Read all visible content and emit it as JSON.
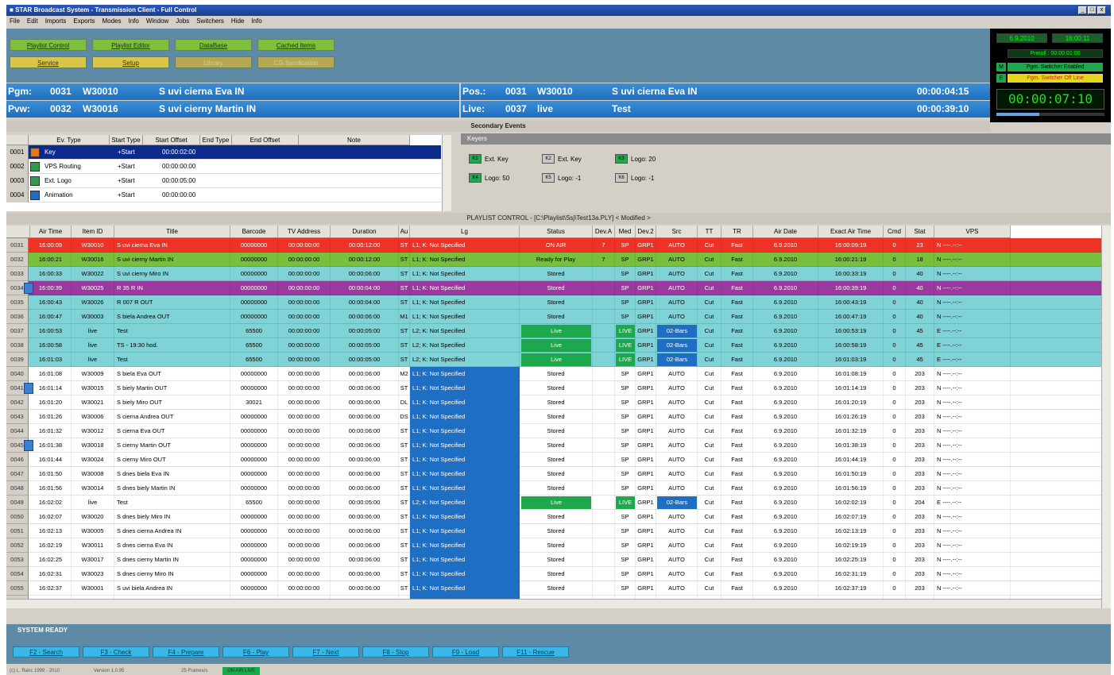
{
  "window": {
    "title": "STAR Broadcast System - Transmission Client - Full Control",
    "controls": [
      "_",
      "□",
      "x"
    ]
  },
  "menu": [
    "File",
    "Edit",
    "Imports",
    "Exports",
    "Modes",
    "Info",
    "Window",
    "Jobs",
    "Switchers",
    "Hide",
    "Info"
  ],
  "toolbar": {
    "row1": [
      {
        "label": "Playlist Control",
        "state": "green"
      },
      {
        "label": "Playlist Editor",
        "state": "green"
      },
      {
        "label": "DataBase",
        "state": "green"
      },
      {
        "label": "Cached Items",
        "state": "green"
      }
    ],
    "row2": [
      {
        "label": "Service",
        "state": "yellow"
      },
      {
        "label": "Setup",
        "state": "yellow"
      },
      {
        "label": "Library",
        "state": "disabled"
      },
      {
        "label": "CG Syndication",
        "state": "disabled"
      }
    ]
  },
  "clock_panel": {
    "date": "6.9.2010",
    "time": "16:00:11",
    "preroll": "Preroll : 00:00:01:00",
    "switch1": "Pgm. Switcher Enabled",
    "switch2": "Pgm. Switcher Off Line",
    "big_clock": "00:00:07:10"
  },
  "pgm": {
    "label": "Pgm:",
    "num": "0031",
    "id": "W30010",
    "title": "S uvi cierna Eva IN"
  },
  "pvw": {
    "label": "Pvw:",
    "num": "0032",
    "id": "W30016",
    "title": "S uvi cierny Martin IN"
  },
  "pos": {
    "label": "Pos.:",
    "num": "0031",
    "id": "W30010",
    "title": "S uvi cierna Eva IN",
    "tc": "00:00:04:15"
  },
  "live": {
    "label": "Live:",
    "num": "0037",
    "id": "live",
    "title": "Test",
    "tc": "00:00:39:10"
  },
  "secondary": {
    "title": "Secondary Events",
    "headers": [
      "Ev. Type",
      "Start Type",
      "Start Offset",
      "End Type",
      "End Offset",
      "Note"
    ],
    "rows": [
      {
        "num": "0001",
        "type": "Key",
        "start_type": "+Start",
        "offset": "00:00:02:00",
        "selected": true
      },
      {
        "num": "0002",
        "type": "VPS Routing",
        "start_type": "+Start",
        "offset": "00:00:00:00",
        "selected": false
      },
      {
        "num": "0003",
        "type": "Ext. Logo",
        "start_type": "+Start",
        "offset": "00:00:05:00",
        "selected": false
      },
      {
        "num": "0004",
        "type": "Animation",
        "start_type": "+Start",
        "offset": "00:00:00:00",
        "selected": false
      }
    ]
  },
  "keyers": {
    "title": "Keyers",
    "items": [
      {
        "label": "Ext. Key",
        "on": true,
        "tag": "K1"
      },
      {
        "label": "Ext. Key",
        "on": false,
        "tag": "K2"
      },
      {
        "label": "Logo: 20",
        "on": true,
        "tag": "K3"
      },
      {
        "label": "Logo: 50",
        "on": true,
        "tag": "K4"
      },
      {
        "label": "Logo: -1",
        "on": false,
        "tag": "K5"
      },
      {
        "label": "Logo: -1",
        "on": false,
        "tag": "K6"
      }
    ]
  },
  "playlist": {
    "title": "PLAYLIST CONTROL - [C:\\Playlist\\Ssj\\Test13a.PLY] < Modified >",
    "headers": [
      "Air Time",
      "Item ID",
      "Title",
      "Barcode",
      "TV Address",
      "Duration",
      "Au",
      "Lg",
      "Status",
      "Dev.A",
      "Med",
      "Dev.2",
      "Src",
      "TT",
      "TR",
      "Air Date",
      "Exact Air Time",
      "Cmd",
      "Stat",
      "VPS"
    ],
    "rows": [
      {
        "n": "0031",
        "ic": false,
        "air": "16:00:09",
        "id": "W30010",
        "title": "S uvi cierna Eva IN",
        "bc": "00000000",
        "tva": "00:00:00:00",
        "dur": "00:00:12:00",
        "au": "ST",
        "lg": "L1; K: Not Specified",
        "status": "ON AIR",
        "deva": "7",
        "med": "SP",
        "dev2": "GRP1",
        "src": "AUTO",
        "tt": "Cut",
        "tr": "Fast",
        "date": "6.9.2010",
        "exact": "16:00:09:19",
        "cmd": "0",
        "stat": "23",
        "vps": "N ----.--:--",
        "bg": "onair"
      },
      {
        "n": "0032",
        "ic": false,
        "air": "16:00:21",
        "id": "W30016",
        "title": "S uvi cierny Martin IN",
        "bc": "00000000",
        "tva": "00:00:00:00",
        "dur": "00:00:12:00",
        "au": "ST",
        "lg": "L1; K: Not Specified",
        "status": "Ready for Play",
        "deva": "7",
        "med": "SP",
        "dev2": "GRP1",
        "src": "AUTO",
        "tt": "Cut",
        "tr": "Fast",
        "date": "6.9.2010",
        "exact": "16:00:21:19",
        "cmd": "0",
        "stat": "18",
        "vps": "N ----.--:--",
        "bg": "ready"
      },
      {
        "n": "0033",
        "ic": false,
        "air": "16:00:33",
        "id": "W30022",
        "title": "S uvi cierny Miro IN",
        "bc": "00000000",
        "tva": "00:00:00:00",
        "dur": "00:00:06:00",
        "au": "ST",
        "lg": "L1; K: Not Specified",
        "status": "Stored",
        "deva": "",
        "med": "SP",
        "dev2": "GRP1",
        "src": "AUTO",
        "tt": "Cut",
        "tr": "Fast",
        "date": "6.9.2010",
        "exact": "16:00:33:19",
        "cmd": "0",
        "stat": "40",
        "vps": "N ----.--:--",
        "bg": "cyan"
      },
      {
        "n": "0034",
        "ic": true,
        "air": "16:00:39",
        "id": "W30025",
        "title": "R 35 R IN",
        "bc": "00000000",
        "tva": "00:00:00:00",
        "dur": "00:00:04:00",
        "au": "ST",
        "lg": "L1; K: Not Specified",
        "status": "Stored",
        "deva": "",
        "med": "SP",
        "dev2": "GRP1",
        "src": "AUTO",
        "tt": "Cut",
        "tr": "Fast",
        "date": "6.9.2010",
        "exact": "16:00:39:19",
        "cmd": "0",
        "stat": "40",
        "vps": "N ----.--:--",
        "bg": "purple"
      },
      {
        "n": "0035",
        "ic": false,
        "air": "16:00:43",
        "id": "W30026",
        "title": "R 007 R OUT",
        "bc": "00000000",
        "tva": "00:00:00:00",
        "dur": "00:00:04:00",
        "au": "ST",
        "lg": "L1; K: Not Specified",
        "status": "Stored",
        "deva": "",
        "med": "SP",
        "dev2": "GRP1",
        "src": "AUTO",
        "tt": "Cut",
        "tr": "Fast",
        "date": "6.9.2010",
        "exact": "16:00:43:19",
        "cmd": "0",
        "stat": "40",
        "vps": "N ----.--:--",
        "bg": "cyan"
      },
      {
        "n": "0036",
        "ic": false,
        "air": "16:00:47",
        "id": "W30003",
        "title": "S biela Andrea OUT",
        "bc": "00000000",
        "tva": "00:00:00:00",
        "dur": "00:00:06:00",
        "au": "M1",
        "lg": "L1; K: Not Specified",
        "status": "Stored",
        "deva": "",
        "med": "SP",
        "dev2": "GRP1",
        "src": "AUTO",
        "tt": "Cut",
        "tr": "Fast",
        "date": "6.9.2010",
        "exact": "16:00:47:19",
        "cmd": "0",
        "stat": "40",
        "vps": "N ----.--:--",
        "bg": "cyan"
      },
      {
        "n": "0037",
        "ic": false,
        "air": "16:00:53",
        "id": "live",
        "title": "Test",
        "bc": "65500",
        "tva": "00:00:00:00",
        "dur": "00:00:05:00",
        "au": "ST",
        "lg": "L2; K: Not Specified",
        "status": "Live",
        "deva": "",
        "med": "LIVE",
        "dev2": "GRP1",
        "src": "02-Bars",
        "tt": "Cut",
        "tr": "Fast",
        "date": "6.9.2010",
        "exact": "16:00:53:19",
        "cmd": "0",
        "stat": "45",
        "vps": "E ----.--:--",
        "bg": "cyan"
      },
      {
        "n": "0038",
        "ic": false,
        "air": "16:00:58",
        "id": "live",
        "title": "TS - 19:30 hod.",
        "bc": "65500",
        "tva": "00:00:00:00",
        "dur": "00:00:05:00",
        "au": "ST",
        "lg": "L2; K: Not Specified",
        "status": "Live",
        "deva": "",
        "med": "LIVE",
        "dev2": "GRP1",
        "src": "02-Bars",
        "tt": "Cut",
        "tr": "Fast",
        "date": "6.9.2010",
        "exact": "16:00:58:19",
        "cmd": "0",
        "stat": "45",
        "vps": "E ----.--:--",
        "bg": "cyan"
      },
      {
        "n": "0039",
        "ic": false,
        "air": "16:01:03",
        "id": "live",
        "title": "Test",
        "bc": "65500",
        "tva": "00:00:00:00",
        "dur": "00:00:05:00",
        "au": "ST",
        "lg": "L2; K: Not Specified",
        "status": "Live",
        "deva": "",
        "med": "LIVE",
        "dev2": "GRP1",
        "src": "02-Bars",
        "tt": "Cut",
        "tr": "Fast",
        "date": "6.9.2010",
        "exact": "16:01:03:19",
        "cmd": "0",
        "stat": "45",
        "vps": "E ----.--:--",
        "bg": "cyan"
      },
      {
        "n": "0040",
        "ic": false,
        "air": "16:01:08",
        "id": "W30009",
        "title": "S biela Eva OUT",
        "bc": "00000000",
        "tva": "00:00:00:00",
        "dur": "00:00:06:00",
        "au": "M2",
        "lg": "L1; K: Not Specified",
        "status": "Stored",
        "deva": "",
        "med": "SP",
        "dev2": "GRP1",
        "src": "AUTO",
        "tt": "Cut",
        "tr": "Fast",
        "date": "6.9.2010",
        "exact": "16:01:08:19",
        "cmd": "0",
        "stat": "203",
        "vps": "N ----.--:--",
        "bg": "white"
      },
      {
        "n": "0041",
        "ic": true,
        "air": "16:01:14",
        "id": "W30015",
        "title": "S biely Martin OUT",
        "bc": "00000000",
        "tva": "00:00:00:00",
        "dur": "00:00:06:00",
        "au": "ST",
        "lg": "L1; K: Not Specified",
        "status": "Stored",
        "deva": "",
        "med": "SP",
        "dev2": "GRP1",
        "src": "AUTO",
        "tt": "Cut",
        "tr": "Fast",
        "date": "6.9.2010",
        "exact": "16:01:14:19",
        "cmd": "0",
        "stat": "203",
        "vps": "N ----.--:--",
        "bg": "white"
      },
      {
        "n": "0042",
        "ic": false,
        "air": "16:01:20",
        "id": "W30021",
        "title": "S biely Miro OUT",
        "bc": "30021",
        "tva": "00:00:00:00",
        "dur": "00:00:06:00",
        "au": "DL",
        "lg": "L1; K: Not Specified",
        "status": "Stored",
        "deva": "",
        "med": "SP",
        "dev2": "GRP1",
        "src": "AUTO",
        "tt": "Cut",
        "tr": "Fast",
        "date": "6.9.2010",
        "exact": "16:01:20:19",
        "cmd": "0",
        "stat": "203",
        "vps": "N ----.--:--",
        "bg": "white"
      },
      {
        "n": "0043",
        "ic": false,
        "air": "16:01:26",
        "id": "W30006",
        "title": "S cierna Andrea OUT",
        "bc": "00000000",
        "tva": "00:00:00:00",
        "dur": "00:00:06:00",
        "au": "DS",
        "lg": "L1; K: Not Specified",
        "status": "Stored",
        "deva": "",
        "med": "SP",
        "dev2": "GRP1",
        "src": "AUTO",
        "tt": "Cut",
        "tr": "Fast",
        "date": "6.9.2010",
        "exact": "16:01:26:19",
        "cmd": "0",
        "stat": "203",
        "vps": "N ----.--:--",
        "bg": "white"
      },
      {
        "n": "0044",
        "ic": false,
        "air": "16:01:32",
        "id": "W30012",
        "title": "S cierna Eva OUT",
        "bc": "00000000",
        "tva": "00:00:00:00",
        "dur": "00:00:06:00",
        "au": "ST",
        "lg": "L1; K: Not Specified",
        "status": "Stored",
        "deva": "",
        "med": "SP",
        "dev2": "GRP1",
        "src": "AUTO",
        "tt": "Cut",
        "tr": "Fast",
        "date": "6.9.2010",
        "exact": "16:01:32:19",
        "cmd": "0",
        "stat": "203",
        "vps": "N ----.--:--",
        "bg": "white"
      },
      {
        "n": "0045",
        "ic": true,
        "air": "16:01:38",
        "id": "W30018",
        "title": "S cierny Martin OUT",
        "bc": "00000000",
        "tva": "00:00:00:00",
        "dur": "00:00:06:00",
        "au": "ST",
        "lg": "L1; K: Not Specified",
        "status": "Stored",
        "deva": "",
        "med": "SP",
        "dev2": "GRP1",
        "src": "AUTO",
        "tt": "Cut",
        "tr": "Fast",
        "date": "6.9.2010",
        "exact": "16:01:38:19",
        "cmd": "0",
        "stat": "203",
        "vps": "N ----.--:--",
        "bg": "white"
      },
      {
        "n": "0046",
        "ic": false,
        "air": "16:01:44",
        "id": "W30024",
        "title": "S cierny Miro OUT",
        "bc": "00000000",
        "tva": "00:00:00:00",
        "dur": "00:00:06:00",
        "au": "ST",
        "lg": "L1; K: Not Specified",
        "status": "Stored",
        "deva": "",
        "med": "SP",
        "dev2": "GRP1",
        "src": "AUTO",
        "tt": "Cut",
        "tr": "Fast",
        "date": "6.9.2010",
        "exact": "16:01:44:19",
        "cmd": "0",
        "stat": "203",
        "vps": "N ----.--:--",
        "bg": "white"
      },
      {
        "n": "0047",
        "ic": false,
        "air": "16:01:50",
        "id": "W30008",
        "title": "S dnes biela Eva IN",
        "bc": "00000000",
        "tva": "00:00:00:00",
        "dur": "00:00:06:00",
        "au": "ST",
        "lg": "L1; K: Not Specified",
        "status": "Stored",
        "deva": "",
        "med": "SP",
        "dev2": "GRP1",
        "src": "AUTO",
        "tt": "Cut",
        "tr": "Fast",
        "date": "6.9.2010",
        "exact": "16:01:50:19",
        "cmd": "0",
        "stat": "203",
        "vps": "N ----.--:--",
        "bg": "white"
      },
      {
        "n": "0048",
        "ic": false,
        "air": "16:01:56",
        "id": "W30014",
        "title": "S dnes biely Martin IN",
        "bc": "00000000",
        "tva": "00:00:00:00",
        "dur": "00:00:06:00",
        "au": "ST",
        "lg": "L1; K: Not Specified",
        "status": "Stored",
        "deva": "",
        "med": "SP",
        "dev2": "GRP1",
        "src": "AUTO",
        "tt": "Cut",
        "tr": "Fast",
        "date": "6.9.2010",
        "exact": "16:01:56:19",
        "cmd": "0",
        "stat": "203",
        "vps": "N ----.--:--",
        "bg": "white"
      },
      {
        "n": "0049",
        "ic": false,
        "air": "16:02:02",
        "id": "live",
        "title": "Test",
        "bc": "65500",
        "tva": "00:00:00:00",
        "dur": "00:00:05:00",
        "au": "ST",
        "lg": "L2; K: Not Specified",
        "status": "Live",
        "deva": "",
        "med": "LIVE",
        "dev2": "GRP1",
        "src": "02-Bars",
        "tt": "Cut",
        "tr": "Fast",
        "date": "6.9.2010",
        "exact": "16:02:02:19",
        "cmd": "0",
        "stat": "204",
        "vps": "E ----.--:--",
        "bg": "white"
      },
      {
        "n": "0050",
        "ic": false,
        "air": "16:02:07",
        "id": "W30020",
        "title": "S dnes biely Miro IN",
        "bc": "00000000",
        "tva": "00:00:00:00",
        "dur": "00:00:06:00",
        "au": "ST",
        "lg": "L1; K: Not Specified",
        "status": "Stored",
        "deva": "",
        "med": "SP",
        "dev2": "GRP1",
        "src": "AUTO",
        "tt": "Cut",
        "tr": "Fast",
        "date": "6.9.2010",
        "exact": "16:02:07:19",
        "cmd": "0",
        "stat": "203",
        "vps": "N ----.--:--",
        "bg": "white"
      },
      {
        "n": "0051",
        "ic": false,
        "air": "16:02:13",
        "id": "W30005",
        "title": "S dnes cierna Andrea IN",
        "bc": "00000000",
        "tva": "00:00:00:00",
        "dur": "00:00:06:00",
        "au": "ST",
        "lg": "L1; K: Not Specified",
        "status": "Stored",
        "deva": "",
        "med": "SP",
        "dev2": "GRP1",
        "src": "AUTO",
        "tt": "Cut",
        "tr": "Fast",
        "date": "6.9.2010",
        "exact": "16:02:13:19",
        "cmd": "0",
        "stat": "203",
        "vps": "N ----.--:--",
        "bg": "white"
      },
      {
        "n": "0052",
        "ic": false,
        "air": "16:02:19",
        "id": "W30011",
        "title": "S dnes cierna Eva IN",
        "bc": "00000000",
        "tva": "00:00:00:00",
        "dur": "00:00:06:00",
        "au": "ST",
        "lg": "L1; K: Not Specified",
        "status": "Stored",
        "deva": "",
        "med": "SP",
        "dev2": "GRP1",
        "src": "AUTO",
        "tt": "Cut",
        "tr": "Fast",
        "date": "6.9.2010",
        "exact": "16:02:19:19",
        "cmd": "0",
        "stat": "203",
        "vps": "N ----.--:--",
        "bg": "white"
      },
      {
        "n": "0053",
        "ic": false,
        "air": "16:02:25",
        "id": "W30017",
        "title": "S dnes cierny Martin IN",
        "bc": "00000000",
        "tva": "00:00:00:00",
        "dur": "00:00:06:00",
        "au": "ST",
        "lg": "L1; K: Not Specified",
        "status": "Stored",
        "deva": "",
        "med": "SP",
        "dev2": "GRP1",
        "src": "AUTO",
        "tt": "Cut",
        "tr": "Fast",
        "date": "6.9.2010",
        "exact": "16:02:25:19",
        "cmd": "0",
        "stat": "203",
        "vps": "N ----.--:--",
        "bg": "white"
      },
      {
        "n": "0054",
        "ic": false,
        "air": "16:02:31",
        "id": "W30023",
        "title": "S dnes cierny Miro IN",
        "bc": "00000000",
        "tva": "00:00:00:00",
        "dur": "00:00:06:00",
        "au": "ST",
        "lg": "L1; K: Not Specified",
        "status": "Stored",
        "deva": "",
        "med": "SP",
        "dev2": "GRP1",
        "src": "AUTO",
        "tt": "Cut",
        "tr": "Fast",
        "date": "6.9.2010",
        "exact": "16:02:31:19",
        "cmd": "0",
        "stat": "203",
        "vps": "N ----.--:--",
        "bg": "white"
      },
      {
        "n": "0055",
        "ic": false,
        "air": "16:02:37",
        "id": "W30001",
        "title": "S uvi biela Andrea IN",
        "bc": "00000000",
        "tva": "00:00:00:00",
        "dur": "00:00:06:00",
        "au": "ST",
        "lg": "L1; K: Not Specified",
        "status": "Stored",
        "deva": "",
        "med": "SP",
        "dev2": "GRP1",
        "src": "AUTO",
        "tt": "Cut",
        "tr": "Fast",
        "date": "6.9.2010",
        "exact": "16:02:37:19",
        "cmd": "0",
        "stat": "203",
        "vps": "N ----.--:--",
        "bg": "white"
      },
      {
        "n": "0056",
        "ic": false,
        "air": "16:02:43",
        "id": "W30007",
        "title": "S uvi biela Eva IN",
        "bc": "00000000",
        "tva": "00:00:00:00",
        "dur": "00:00:06:00",
        "au": "ST",
        "lg": "L1; K: Not Specified",
        "status": "Stored",
        "deva": "",
        "med": "SP",
        "dev2": "GRP1",
        "src": "AUTO",
        "tt": "Cut",
        "tr": "Fast",
        "date": "6.9.2010",
        "exact": "16:02:43:19",
        "cmd": "0",
        "stat": "203",
        "vps": "N ----.--:--",
        "bg": "white"
      }
    ]
  },
  "system_status": "SYSTEM READY",
  "fkeys": [
    "F2 - Search",
    "F3 - Check",
    "F4 - Prepare",
    "F6 - Play",
    "F7 - Next",
    "F8 - Stop",
    "F9 - Load",
    "F11 - Rescue"
  ],
  "statusbar": {
    "copyright": "(c) L. Ranc 1999 - 2010",
    "version": "Version 1.0.95",
    "mode": "25 Frames/s",
    "state": "ON AIR LIVE"
  },
  "colors": {
    "onair": "#ef3226",
    "ready": "#77bf3c",
    "cyan": "#7fd2d6",
    "purple": "#9a3a9e",
    "white": "#ffffff",
    "lg_blue": "#1e6fc4",
    "live_green": "#1da84d",
    "bars_blue": "#1e6fc4",
    "info_blue": "#2a7fcd"
  }
}
